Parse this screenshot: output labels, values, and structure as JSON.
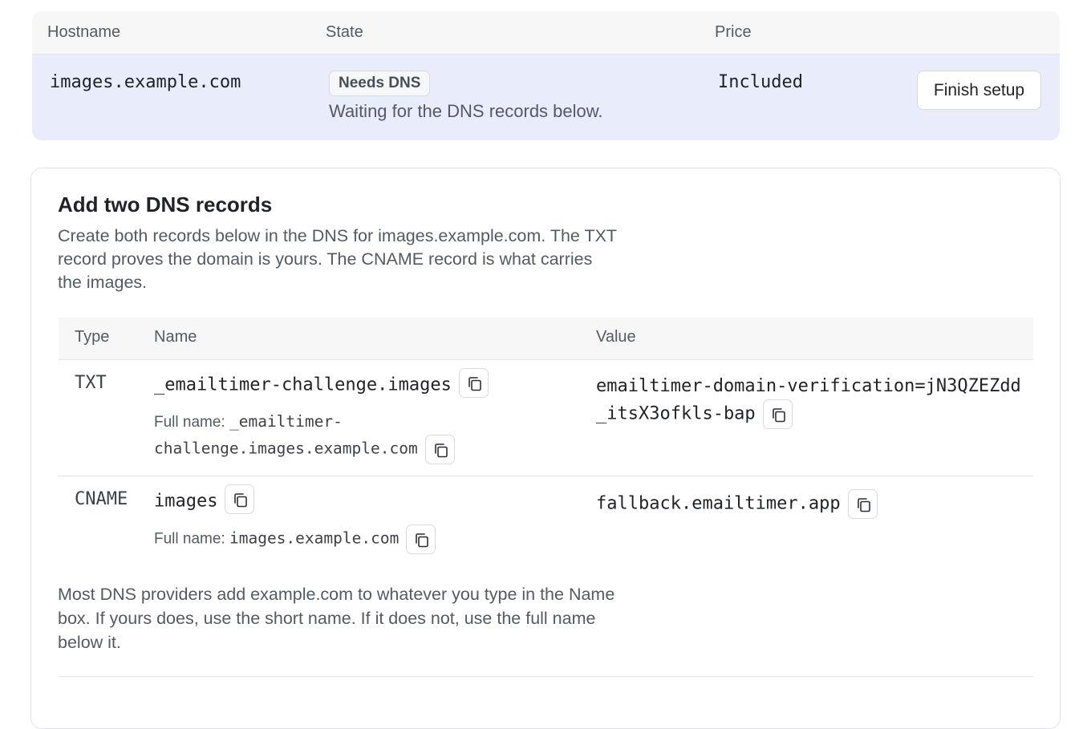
{
  "hosts_table": {
    "headers": {
      "hostname": "Hostname",
      "state": "State",
      "price": "Price"
    },
    "row": {
      "hostname": "images.example.com",
      "state_badge": "Needs DNS",
      "state_note": "Waiting for the DNS records below.",
      "price": "Included",
      "action_label": "Finish setup"
    }
  },
  "dns_card": {
    "title": "Add two DNS records",
    "description": "Create both records below in the DNS for images.example.com. The TXT record proves the domain is yours. The CNAME record is what carries the images.",
    "headers": {
      "type": "Type",
      "name": "Name",
      "value": "Value"
    },
    "full_name_label": "Full name:",
    "records": [
      {
        "type": "TXT",
        "name": "_emailtimer-challenge.images",
        "full_name_part1": "_emailtimer-",
        "full_name_part2": "challenge.images.example.com",
        "value": "emailtimer-domain-verification=jN3QZEZdd_itsX3ofkls-bap"
      },
      {
        "type": "CNAME",
        "name": "images",
        "full_name": "images.example.com",
        "value": "fallback.emailtimer.app"
      }
    ],
    "footer_note": "Most DNS providers add example.com to whatever you type in the Name box. If yours does, use the short name. If it does not, use the full name below it."
  },
  "icons": {
    "copy": "copy-icon"
  },
  "colors": {
    "highlight_row": "#e9ecfb",
    "muted_text": "#545a63",
    "border": "#e3e4e8"
  }
}
